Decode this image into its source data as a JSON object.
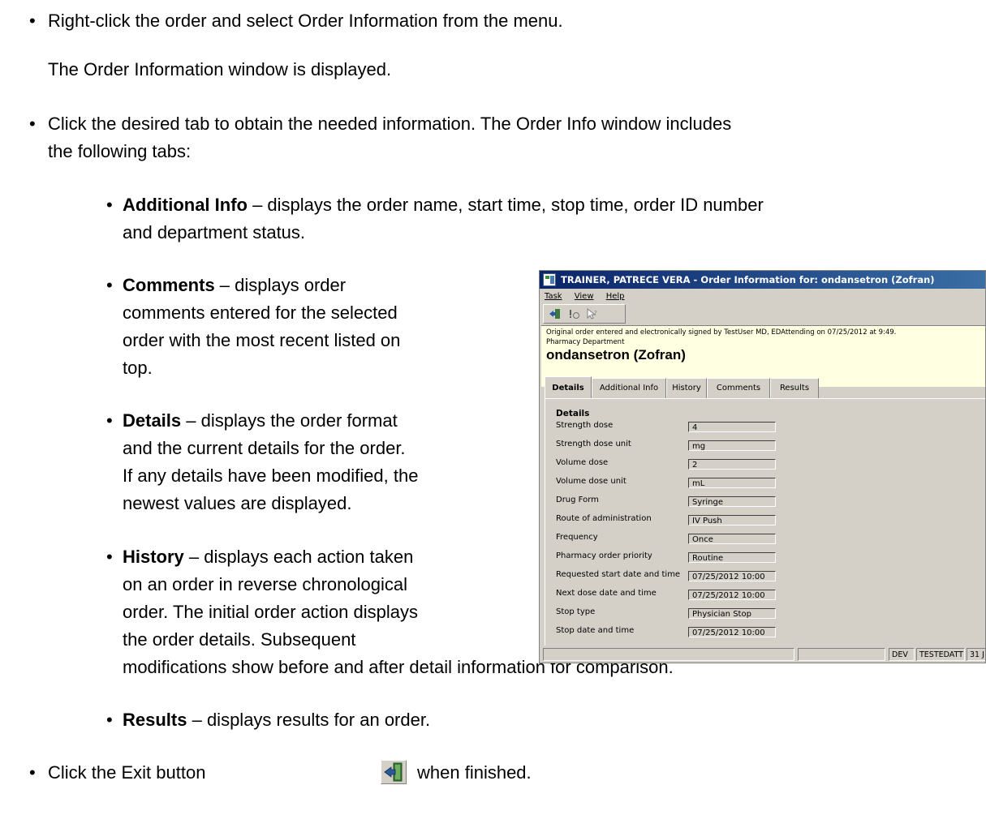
{
  "doc": {
    "bullet1": "Right-click the order and select Order Information from the menu.",
    "para1": "The Order Information window is displayed.",
    "bullet2_line1": "Click the desired tab to obtain the needed information.  The Order Info window includes",
    "bullet2_line2": "the following tabs:",
    "additional_info_term": "Additional Info",
    "additional_info_line1": " – displays the order name, start time, stop time, order ID number",
    "additional_info_line2": "and department status.",
    "comments_term": "Comments",
    "comments_line1": " – displays order",
    "comments_line2": "comments entered for the selected",
    "comments_line3": "order with the most recent listed on",
    "comments_line4": "top.",
    "details_term": "Details",
    "details_line1": " – displays the order format",
    "details_line2": "and the current details for the order.",
    "details_line3": "If any details have been modified, the",
    "details_line4": "newest values are displayed.",
    "history_term": "History",
    "history_line1": " – displays each action taken",
    "history_line2": "on an order in reverse chronological",
    "history_line3": "order. The initial order action displays",
    "history_line4": "the order details. Subsequent",
    "history_line5": "modifications show before and after detail information for comparison.",
    "results_term": "Results",
    "results_line1": " – displays results for an order.",
    "exit_pre": "Click the Exit button",
    "exit_post": "when finished.",
    "bullet_glyph": "•"
  },
  "window": {
    "title": "TRAINER, PATRECE VERA - Order Information for:  ondansetron (Zofran)",
    "menu": [
      "Task",
      "View",
      "Help"
    ],
    "info_line1": "Original order entered and electronically signed by TestUser MD, EDAttending on 07/25/2012 at 9:49.",
    "info_line2": "Pharmacy Department",
    "order_name": "ondansetron (Zofran)",
    "tabs": [
      "Details",
      "Additional Info",
      "History",
      "Comments",
      "Results"
    ],
    "active_tab": "Details",
    "panel_title": "Details",
    "fields": [
      {
        "label": "Strength dose",
        "value": "4"
      },
      {
        "label": "Strength dose unit",
        "value": "mg"
      },
      {
        "label": "Volume dose",
        "value": "2"
      },
      {
        "label": "Volume dose unit",
        "value": "mL"
      },
      {
        "label": "Drug Form",
        "value": "Syringe"
      },
      {
        "label": "Route of administration",
        "value": "IV Push"
      },
      {
        "label": "Frequency",
        "value": "Once"
      },
      {
        "label": "Pharmacy order priority",
        "value": "Routine"
      },
      {
        "label": "Requested start date and time",
        "value": "07/25/2012 10:00"
      },
      {
        "label": "Next dose date and time",
        "value": "07/25/2012 10:00"
      },
      {
        "label": "Stop type",
        "value": "Physician Stop"
      },
      {
        "label": "Stop date and time",
        "value": "07/25/2012 10:00"
      }
    ],
    "status": [
      "DEV",
      "TESTEDATT",
      "31 J"
    ]
  }
}
